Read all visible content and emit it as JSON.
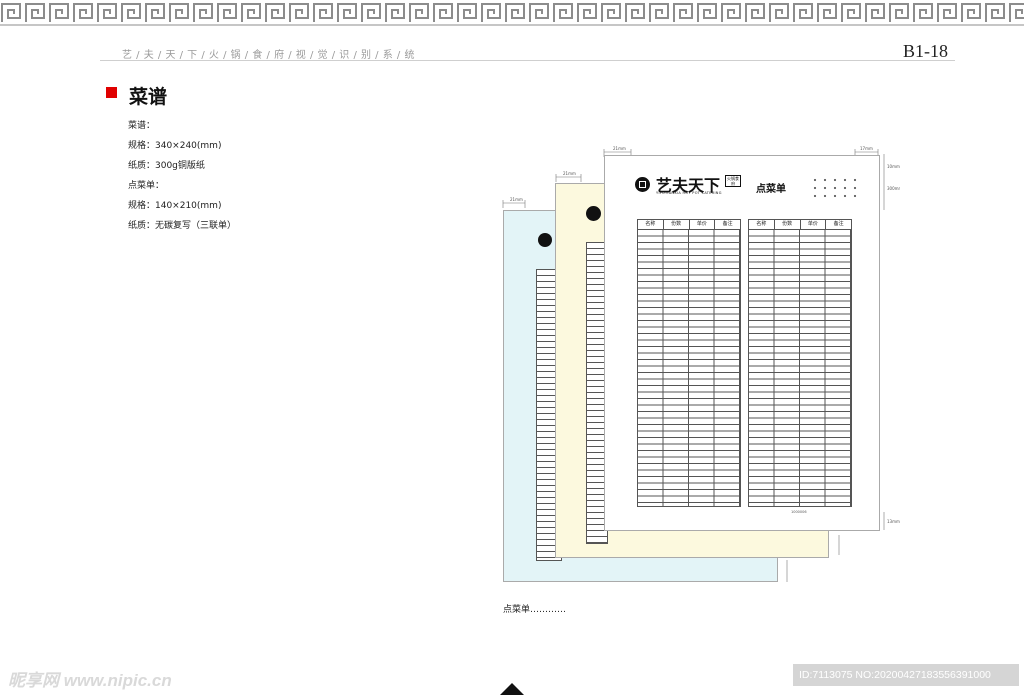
{
  "header": {
    "vi_subtitle": "艺 / 夫 / 天 / 下 / 火 / 锅 / 食 / 府 / 视 / 觉 / 识 / 别 / 系 / 统",
    "page_code": "B1-18"
  },
  "section": {
    "title": "菜谱",
    "specs": [
      "菜谱：",
      "规格：340×240(mm)",
      "纸质：300g铜版纸",
      "点菜单：",
      "规格：140×210(mm)",
      "纸质：无碳复写（三联单）"
    ]
  },
  "form": {
    "brand_name": "艺夫天下",
    "brand_tag": "火锅食府",
    "brand_en": "YIFUTIANXIA HOT POT CATERING",
    "title": "点菜单",
    "columns": [
      "名称",
      "份数",
      "单价",
      "备注"
    ],
    "serial": "1000006",
    "dimension_labels": [
      "21mm",
      "17mm",
      "10mm",
      "13mm",
      "300mm"
    ]
  },
  "colors": {
    "accent_red": "#e00000",
    "copy_blue": "#e3f4f7",
    "copy_yellow": "#fcf9de",
    "copy_white": "#ffffff"
  },
  "caption": "点菜单…………",
  "watermark": {
    "left_text": "昵享网 www.nipic.cn",
    "right_text": "ID:7113075 NO:20200427183556391000"
  }
}
